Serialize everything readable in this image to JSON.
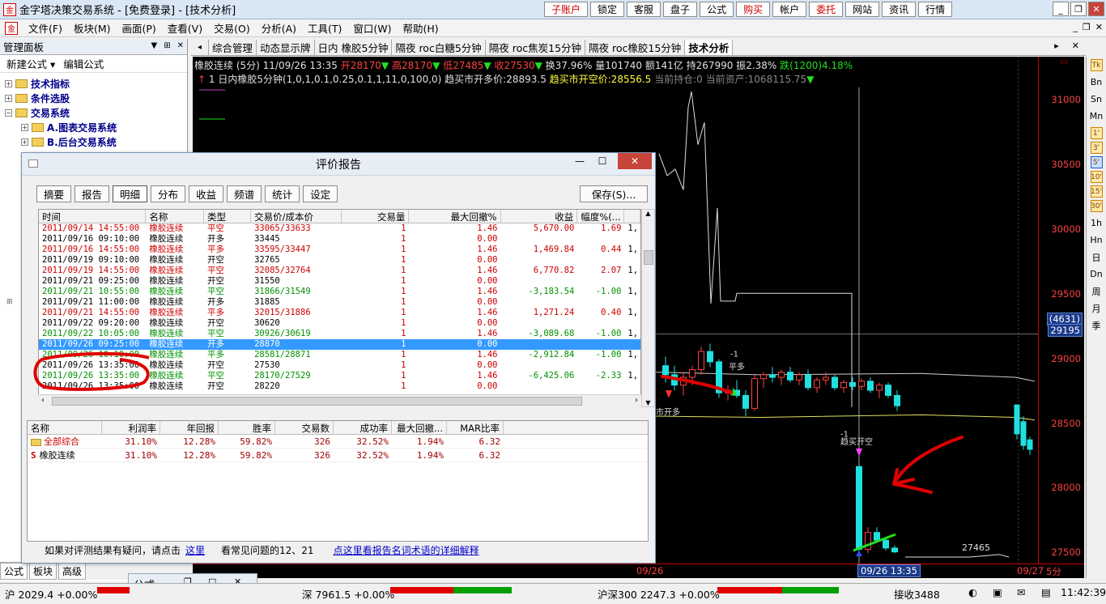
{
  "titlebar": {
    "title": "金字塔决策交易系统 - [免费登录] - [技术分析]",
    "buttons": [
      {
        "label": "子账户",
        "red": true
      },
      {
        "label": "锁定",
        "red": false
      },
      {
        "label": "客服",
        "red": false
      },
      {
        "label": "盘子",
        "red": false
      },
      {
        "label": "公式",
        "red": false
      },
      {
        "label": "购买",
        "red": true
      },
      {
        "label": "帐户",
        "red": false
      },
      {
        "label": "委托",
        "red": true
      },
      {
        "label": "网站",
        "red": false
      },
      {
        "label": "资讯",
        "red": false
      },
      {
        "label": "行情",
        "red": false
      }
    ],
    "ctrls": [
      "_",
      "❐",
      "✕"
    ]
  },
  "menubar": {
    "items": [
      "文件(F)",
      "板块(M)",
      "画面(P)",
      "查看(V)",
      "交易(O)",
      "分析(A)",
      "工具(T)",
      "窗口(W)",
      "帮助(H)"
    ],
    "ctrls": [
      "_",
      "❐",
      "✕"
    ]
  },
  "leftpanel": {
    "header": "管理面板",
    "header_btns": [
      "▼",
      "⊞",
      "✕"
    ],
    "toolbar": [
      "新建公式 ▾",
      "编辑公式"
    ],
    "tree": [
      {
        "label": "技术指标",
        "indent": 0
      },
      {
        "label": "条件选股",
        "indent": 0
      },
      {
        "label": "交易系统",
        "indent": 0,
        "expanded": true
      },
      {
        "label": "A.图表交易系统",
        "indent": 1
      },
      {
        "label": "B.后台交易系统",
        "indent": 1
      }
    ],
    "tabs": [
      "公式",
      "板块",
      "高级",
      "公式..."
    ]
  },
  "tabbar": {
    "tabs": [
      "综合管理",
      "动态显示牌",
      "日内 橡胶5分钟",
      "隔夜 roc白糖5分钟",
      "隔夜 roc焦炭15分钟",
      "隔夜 roc橡胶15分钟",
      "技术分析"
    ],
    "active": 6
  },
  "chart": {
    "info_line1": [
      {
        "text": "橡胶连续 (5分) 11/09/26 13:35 ",
        "color": "white"
      },
      {
        "text": "开28170",
        "color": "red"
      },
      {
        "text": "▼",
        "color": "green"
      },
      {
        "text": " 高28170",
        "color": "red"
      },
      {
        "text": "▼",
        "color": "green"
      },
      {
        "text": " 低27485",
        "color": "red"
      },
      {
        "text": "▼",
        "color": "green"
      },
      {
        "text": " 收27530",
        "color": "red"
      },
      {
        "text": "▼",
        "color": "green"
      },
      {
        "text": " 换37.96% 量101740 额141亿 持267990 振2.38% ",
        "color": "white"
      },
      {
        "text": "跌(1200)4.18%",
        "color": "green"
      }
    ],
    "info_line2": [
      {
        "text": "↑ ",
        "color": "red"
      },
      {
        "text": "1 日内橡胶5分钟(1,0,1,0.1,0.25,0.1,1,11,0,100,0) ",
        "color": "white"
      },
      {
        "text": "趋买市开多价:28893.5 ",
        "color": "white"
      },
      {
        "text": "趋买市开空价:28556.5 ",
        "color": "yellow"
      },
      {
        "text": "当前持仓:0 当前资产:1068115.75",
        "color": "gray"
      },
      {
        "text": "▼",
        "color": "green"
      }
    ],
    "price_ticks": [
      31000,
      30500,
      30000,
      29500,
      29000,
      28500,
      28000,
      27500
    ],
    "price_range": [
      27420,
      31340
    ],
    "cursor_price": "29195",
    "cursor_count": "(4631)",
    "marker_low": "27465",
    "annotations": [
      "-1",
      "平多",
      "市开多",
      "-1",
      "趋买开空"
    ],
    "date_labels": [
      "09/26",
      "09/26 13:35",
      "09/27",
      "5分"
    ],
    "candles": [
      {
        "o": 28950,
        "h": 29020,
        "l": 28820,
        "c": 28880,
        "up": false
      },
      {
        "o": 28880,
        "h": 28950,
        "l": 28760,
        "c": 28800,
        "up": false
      },
      {
        "o": 28800,
        "h": 28900,
        "l": 28720,
        "c": 28860,
        "up": true
      },
      {
        "o": 28860,
        "h": 28950,
        "l": 28800,
        "c": 28920,
        "up": true
      },
      {
        "o": 28920,
        "h": 29100,
        "l": 28880,
        "c": 29060,
        "up": true
      },
      {
        "o": 29060,
        "h": 29120,
        "l": 28940,
        "c": 28980,
        "up": false
      },
      {
        "o": 28980,
        "h": 29000,
        "l": 28700,
        "c": 28740,
        "up": false
      },
      {
        "o": 28740,
        "h": 28800,
        "l": 28680,
        "c": 28760,
        "up": true
      },
      {
        "o": 28760,
        "h": 28840,
        "l": 28700,
        "c": 28720,
        "up": false
      },
      {
        "o": 28720,
        "h": 28760,
        "l": 28560,
        "c": 28620,
        "up": false
      },
      {
        "o": 28620,
        "h": 28880,
        "l": 28600,
        "c": 28850,
        "up": true
      },
      {
        "o": 28850,
        "h": 28900,
        "l": 28780,
        "c": 28880,
        "up": true
      },
      {
        "o": 28880,
        "h": 28940,
        "l": 28820,
        "c": 28860,
        "up": false
      },
      {
        "o": 28860,
        "h": 28920,
        "l": 28800,
        "c": 28900,
        "up": true
      },
      {
        "o": 28900,
        "h": 28940,
        "l": 28820,
        "c": 28840,
        "up": false
      },
      {
        "o": 28840,
        "h": 28900,
        "l": 28800,
        "c": 28880,
        "up": true
      },
      {
        "o": 28880,
        "h": 28920,
        "l": 28760,
        "c": 28780,
        "up": false
      },
      {
        "o": 28780,
        "h": 28860,
        "l": 28740,
        "c": 28840,
        "up": true
      },
      {
        "o": 28840,
        "h": 28900,
        "l": 28800,
        "c": 28860,
        "up": true
      },
      {
        "o": 28860,
        "h": 28880,
        "l": 28760,
        "c": 28780,
        "up": false
      },
      {
        "o": 28780,
        "h": 28840,
        "l": 28740,
        "c": 28820,
        "up": true
      },
      {
        "o": 28820,
        "h": 28860,
        "l": 28760,
        "c": 28790,
        "up": false
      },
      {
        "o": 28790,
        "h": 28850,
        "l": 28760,
        "c": 28830,
        "up": true
      },
      {
        "o": 28830,
        "h": 28860,
        "l": 28740,
        "c": 28760,
        "up": false
      },
      {
        "o": 28760,
        "h": 28820,
        "l": 28700,
        "c": 28800,
        "up": true
      },
      {
        "o": 28800,
        "h": 28820,
        "l": 28700,
        "c": 28720,
        "up": false
      },
      {
        "o": 28720,
        "h": 28760,
        "l": 28600,
        "c": 28640,
        "up": false
      },
      {
        "o": 28170,
        "h": 28170,
        "l": 27485,
        "c": 27530,
        "up": false
      },
      {
        "o": 27530,
        "h": 27700,
        "l": 27500,
        "c": 27660,
        "up": true
      },
      {
        "o": 27660,
        "h": 27700,
        "l": 27580,
        "c": 27600,
        "up": false
      },
      {
        "o": 27600,
        "h": 27620,
        "l": 27520,
        "c": 27540,
        "up": false
      },
      {
        "o": 27540,
        "h": 27560,
        "l": 27500,
        "c": 27510,
        "up": false
      }
    ]
  },
  "rtool": {
    "items": [
      "Tk",
      "Bn",
      "Sn",
      "Mn",
      "1'",
      "3'",
      "5'",
      "10'",
      "15'",
      "30'",
      "1h",
      "Hn",
      "日",
      "Dn",
      "周",
      "月",
      "季"
    ]
  },
  "dialog": {
    "title": "评价报告",
    "ctrls": [
      "—",
      "☐",
      "✕"
    ],
    "buttons": [
      "摘要",
      "报告",
      "明细",
      "分布",
      "收益",
      "频谱",
      "统计",
      "设定"
    ],
    "selected_button": 2,
    "save_label": "保存(S)...",
    "columns": [
      "时间",
      "名称",
      "类型",
      "交易价/成本价",
      "交易量",
      "最大回撤%",
      "收益",
      "幅度%(...",
      ""
    ],
    "rows": [
      {
        "time": "2011/09/14 14:55:00",
        "name": "橡胶连续",
        "type": "平空",
        "price": "33065/33633",
        "qty": "1",
        "dd": "1.46",
        "profit": "5,670.00",
        "pct": "1.69",
        "extra": "1,",
        "color": "red"
      },
      {
        "time": "2011/09/16 09:10:00",
        "name": "橡胶连续",
        "type": "开多",
        "price": "33445",
        "qty": "1",
        "dd": "0.00",
        "profit": "",
        "pct": "",
        "extra": "",
        "color": "black"
      },
      {
        "time": "2011/09/16 14:55:00",
        "name": "橡胶连续",
        "type": "平多",
        "price": "33595/33447",
        "qty": "1",
        "dd": "1.46",
        "profit": "1,469.84",
        "pct": "0.44",
        "extra": "1,",
        "color": "red"
      },
      {
        "time": "2011/09/19 09:10:00",
        "name": "橡胶连续",
        "type": "开空",
        "price": "32765",
        "qty": "1",
        "dd": "0.00",
        "profit": "",
        "pct": "",
        "extra": "",
        "color": "black"
      },
      {
        "time": "2011/09/19 14:55:00",
        "name": "橡胶连续",
        "type": "平空",
        "price": "32085/32764",
        "qty": "1",
        "dd": "1.46",
        "profit": "6,770.82",
        "pct": "2.07",
        "extra": "1,",
        "color": "red"
      },
      {
        "time": "2011/09/21 09:25:00",
        "name": "橡胶连续",
        "type": "开空",
        "price": "31550",
        "qty": "1",
        "dd": "0.00",
        "profit": "",
        "pct": "",
        "extra": "",
        "color": "black"
      },
      {
        "time": "2011/09/21 10:55:00",
        "name": "橡胶连续",
        "type": "平空",
        "price": "31866/31549",
        "qty": "1",
        "dd": "1.46",
        "profit": "-3,183.54",
        "pct": "-1.00",
        "extra": "1,",
        "color": "green"
      },
      {
        "time": "2011/09/21 11:00:00",
        "name": "橡胶连续",
        "type": "开多",
        "price": "31885",
        "qty": "1",
        "dd": "0.00",
        "profit": "",
        "pct": "",
        "extra": "",
        "color": "black"
      },
      {
        "time": "2011/09/21 14:55:00",
        "name": "橡胶连续",
        "type": "平多",
        "price": "32015/31886",
        "qty": "1",
        "dd": "1.46",
        "profit": "1,271.24",
        "pct": "0.40",
        "extra": "1,",
        "color": "red"
      },
      {
        "time": "2011/09/22 09:20:00",
        "name": "橡胶连续",
        "type": "开空",
        "price": "30620",
        "qty": "1",
        "dd": "0.00",
        "profit": "",
        "pct": "",
        "extra": "",
        "color": "black"
      },
      {
        "time": "2011/09/22 10:05:00",
        "name": "橡胶连续",
        "type": "平空",
        "price": "30926/30619",
        "qty": "1",
        "dd": "1.46",
        "profit": "-3,089.68",
        "pct": "-1.00",
        "extra": "1,",
        "color": "green"
      },
      {
        "time": "2011/09/26 09:25:00",
        "name": "橡胶连续",
        "type": "开多",
        "price": "28870",
        "qty": "1",
        "dd": "0.00",
        "profit": "",
        "pct": "",
        "extra": "",
        "color": "selected"
      },
      {
        "time": "2011/09/26 10:10:00",
        "name": "橡胶连续",
        "type": "平多",
        "price": "28581/28871",
        "qty": "1",
        "dd": "1.46",
        "profit": "-2,912.84",
        "pct": "-1.00",
        "extra": "1,",
        "color": "green"
      },
      {
        "time": "2011/09/26 13:35:00",
        "name": "橡胶连续",
        "type": "开空",
        "price": "27530",
        "qty": "1",
        "dd": "0.00",
        "profit": "",
        "pct": "",
        "extra": "",
        "color": "black"
      },
      {
        "time": "2011/09/26 13:35:00",
        "name": "橡胶连续",
        "type": "平空",
        "price": "28170/27529",
        "qty": "1",
        "dd": "1.46",
        "profit": "-6,425.06",
        "pct": "-2.33",
        "extra": "1,",
        "color": "green"
      },
      {
        "time": "2011/09/26 13:35:00",
        "name": "橡胶连续",
        "type": "开空",
        "price": "28220",
        "qty": "1",
        "dd": "0.00",
        "profit": "",
        "pct": "",
        "extra": "",
        "color": "black"
      }
    ],
    "summary_columns": [
      "名称",
      "利润率",
      "年回报",
      "胜率",
      "交易数",
      "成功率",
      "最大回撤...",
      "MAR比率"
    ],
    "summary_rows": [
      {
        "icon": "folder",
        "name": "全部综合",
        "profit": "31.10%",
        "annual": "12.28%",
        "win": "59.82%",
        "count": "326",
        "success": "32.52%",
        "dd": "1.94%",
        "mar": "6.32",
        "red": true
      },
      {
        "icon": "S",
        "name": "橡胶连续",
        "profit": "31.10%",
        "annual": "12.28%",
        "win": "59.82%",
        "count": "326",
        "success": "32.52%",
        "dd": "1.94%",
        "mar": "6.32",
        "red": false
      }
    ],
    "footer_text": "如果对评测结果有疑问，请点击",
    "footer_link1": "这里",
    "footer_text2": "看常见问题的12、21",
    "footer_link2": "点这里看报告名词术语的详细解释"
  },
  "floatwin": {
    "label": "公式...",
    "ctrls": [
      "❐",
      "□",
      "✕"
    ]
  },
  "statusbar": {
    "sh": "沪 2029.4 +0.00%",
    "sz": "深 7961.5 +0.00%",
    "hs300": "沪深300  2247.3 +0.00%",
    "recv": "接收3488",
    "time": "11:42:39"
  }
}
